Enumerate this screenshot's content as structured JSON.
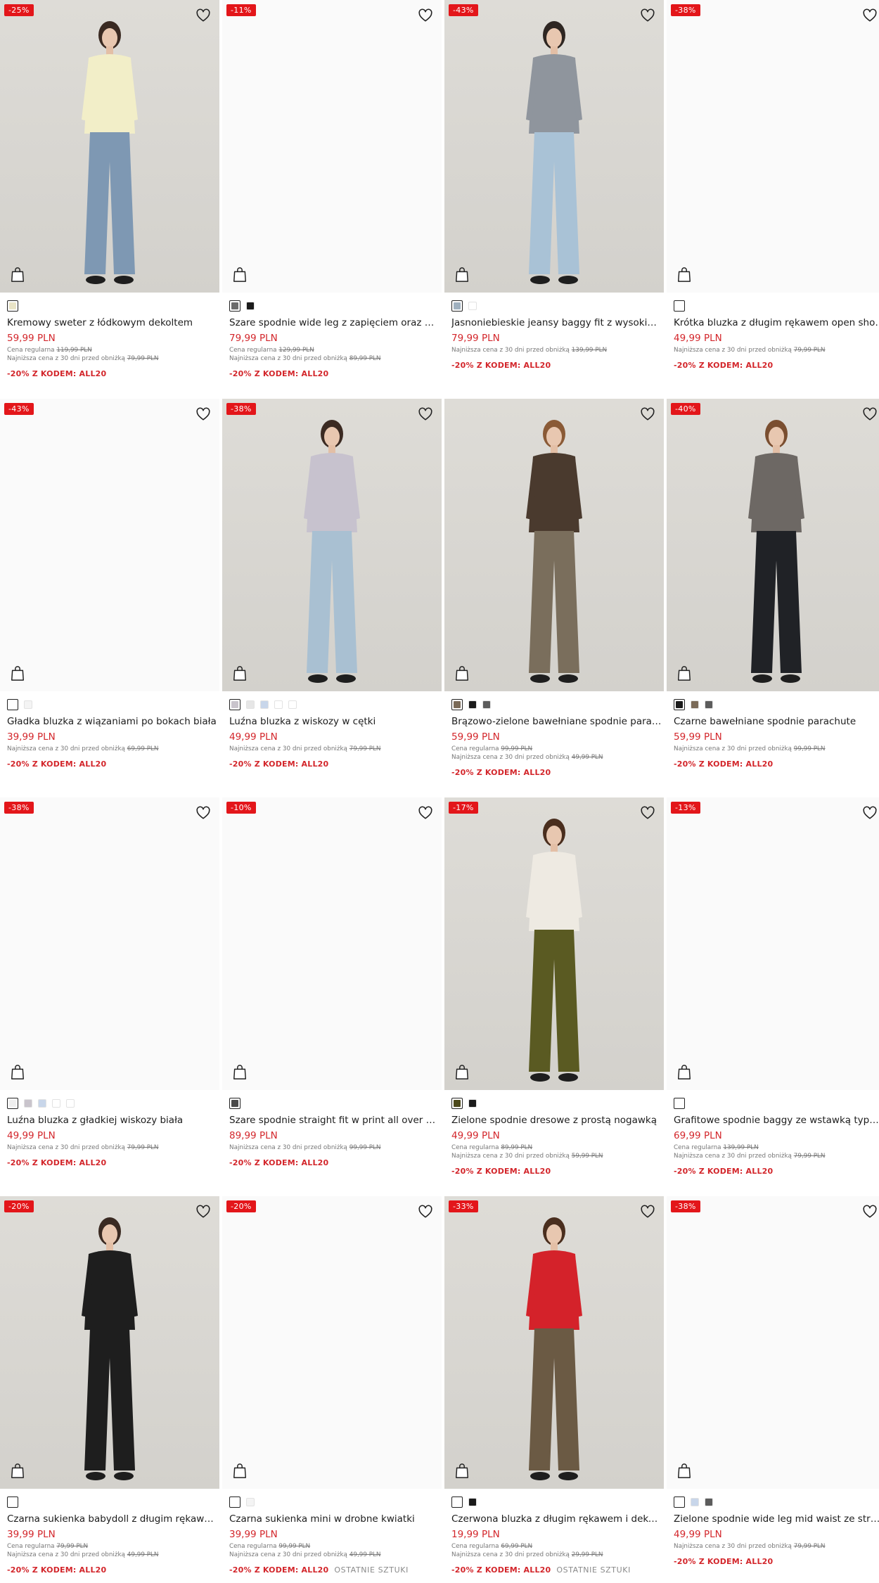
{
  "currency_note": "PLN",
  "products": [
    {
      "badge": "-25%",
      "photo": true,
      "title": "Kremowy sweter z łódkowym dekoltem",
      "price": "59,99 PLN",
      "regular_label": "Cena regularna",
      "regular_price": "119,99 PLN",
      "lowest_label": "Najniższa cena z 30 dni przed obniżką",
      "lowest_price": "79,99 PLN",
      "promo": "-20% Z KODEM: ALL20",
      "extra": "",
      "swatches": [
        "#e9e4c6"
      ],
      "figure": {
        "top": "#f2eec8",
        "bottom": "#7e98b3",
        "hair": "#3a2a22"
      }
    },
    {
      "badge": "-11%",
      "photo": false,
      "title": "Szare spodnie wide leg z zapięciem oraz wiązaniem",
      "price": "79,99 PLN",
      "regular_label": "Cena regularna",
      "regular_price": "129,99 PLN",
      "lowest_label": "Najniższa cena z 30 dni przed obniżką",
      "lowest_price": "89,99 PLN",
      "promo": "-20% Z KODEM: ALL20",
      "extra": "",
      "swatches": [
        "#6b6b6b",
        "#1b1b1b"
      ]
    },
    {
      "badge": "-43%",
      "photo": true,
      "title": "Jasnoniebieskie jeansy baggy fit z wysokim stanem",
      "price": "79,99 PLN",
      "regular_label": "",
      "regular_price": "",
      "lowest_label": "Najniższa cena z 30 dni przed obniżką",
      "lowest_price": "139,99 PLN",
      "promo": "-20% Z KODEM: ALL20",
      "extra": "",
      "swatches": [
        "#9fb0bf",
        "#ffffff"
      ],
      "figure": {
        "top": "#8f959d",
        "bottom": "#a9c2d6",
        "hair": "#2e2622"
      }
    },
    {
      "badge": "-38%",
      "photo": false,
      "title": "Krótka bluzka z długim rękawem open shoulder",
      "price": "49,99 PLN",
      "regular_label": "",
      "regular_price": "",
      "lowest_label": "Najniższa cena z 30 dni przed obniżką",
      "lowest_price": "79,99 PLN",
      "promo": "-20% Z KODEM: ALL20",
      "extra": "",
      "swatches": [
        "#ffffff"
      ]
    },
    {
      "badge": "-43%",
      "photo": false,
      "title": "Gładka bluzka z wiązaniami po bokach biała",
      "price": "39,99 PLN",
      "regular_label": "",
      "regular_price": "",
      "lowest_label": "Najniższa cena z 30 dni przed obniżką",
      "lowest_price": "69,99 PLN",
      "promo": "-20% Z KODEM: ALL20",
      "extra": "",
      "swatches": [
        "#ffffff",
        "#f4f4f4"
      ]
    },
    {
      "badge": "-38%",
      "photo": true,
      "title": "Luźna bluzka z wiskozy w cętki",
      "price": "49,99 PLN",
      "regular_label": "",
      "regular_price": "",
      "lowest_label": "Najniższa cena z 30 dni przed obniżką",
      "lowest_price": "79,99 PLN",
      "promo": "-20% Z KODEM: ALL20",
      "extra": "",
      "swatches": [
        "#c9c4cc",
        "#e6e6e6",
        "#c8d6ea",
        "#ffffff",
        "#ffffff"
      ],
      "figure": {
        "top": "#c7c2ce",
        "bottom": "#a9c0d2",
        "hair": "#3b2a22"
      }
    },
    {
      "badge": "",
      "photo": true,
      "title": "Brązowo-zielone bawełniane spodnie parachute",
      "price": "59,99 PLN",
      "regular_label": "Cena regularna",
      "regular_price": "99,99 PLN",
      "lowest_label": "Najniższa cena z 30 dni przed obniżką",
      "lowest_price": "49,99 PLN",
      "promo": "-20% Z KODEM: ALL20",
      "extra": "",
      "swatches": [
        "#7a6a58",
        "#1b1b1b",
        "#5c5c5c"
      ],
      "figure": {
        "top": "#4a3a2e",
        "bottom": "#7a6e5c",
        "hair": "#8a5a36"
      }
    },
    {
      "badge": "-40%",
      "photo": true,
      "title": "Czarne bawełniane spodnie parachute",
      "price": "59,99 PLN",
      "regular_label": "",
      "regular_price": "",
      "lowest_label": "Najniższa cena z 30 dni przed obniżką",
      "lowest_price": "99,99 PLN",
      "promo": "-20% Z KODEM: ALL20",
      "extra": "",
      "swatches": [
        "#1b1b1b",
        "#7a6a58",
        "#5c5c5c"
      ],
      "figure": {
        "top": "#6d6864",
        "bottom": "#202226",
        "hair": "#7a4e30"
      }
    },
    {
      "badge": "-38%",
      "photo": false,
      "title": "Luźna bluzka z gładkiej wiskozy biała",
      "price": "49,99 PLN",
      "regular_label": "",
      "regular_price": "",
      "lowest_label": "Najniższa cena z 30 dni przed obniżką",
      "lowest_price": "79,99 PLN",
      "promo": "-20% Z KODEM: ALL20",
      "extra": "",
      "swatches": [
        "#efefef",
        "#c9c4cc",
        "#c8d6ea",
        "#ffffff",
        "#ffffff"
      ]
    },
    {
      "badge": "-10%",
      "photo": false,
      "title": "Szare spodnie straight fit w print all over Hello Kitty",
      "price": "89,99 PLN",
      "regular_label": "",
      "regular_price": "",
      "lowest_label": "Najniższa cena z 30 dni przed obniżką",
      "lowest_price": "99,99 PLN",
      "promo": "-20% Z KODEM: ALL20",
      "extra": "",
      "swatches": [
        "#4a4a4a"
      ]
    },
    {
      "badge": "-17%",
      "photo": true,
      "title": "Zielone spodnie dresowe z prostą nogawką",
      "price": "49,99 PLN",
      "regular_label": "Cena regularna",
      "regular_price": "89,99 PLN",
      "lowest_label": "Najniższa cena z 30 dni przed obniżką",
      "lowest_price": "59,99 PLN",
      "promo": "-20% Z KODEM: ALL20",
      "extra": "",
      "swatches": [
        "#4d4a1c",
        "#1b1b1b"
      ],
      "figure": {
        "top": "#eeeae2",
        "bottom": "#5a5a22",
        "hair": "#4a2e1e"
      }
    },
    {
      "badge": "-13%",
      "photo": false,
      "title": "Grafitowe spodnie baggy ze wstawką typu bokserka",
      "price": "69,99 PLN",
      "regular_label": "Cena regularna",
      "regular_price": "139,99 PLN",
      "lowest_label": "Najniższa cena z 30 dni przed obniżką",
      "lowest_price": "79,99 PLN",
      "promo": "-20% Z KODEM: ALL20",
      "extra": "",
      "swatches": [
        "#ffffff"
      ]
    },
    {
      "badge": "-20%",
      "photo": true,
      "title": "Czarna sukienka babydoll z długim rękawem",
      "price": "39,99 PLN",
      "regular_label": "Cena regularna",
      "regular_price": "79,99 PLN",
      "lowest_label": "Najniższa cena z 30 dni przed obniżką",
      "lowest_price": "49,99 PLN",
      "promo": "-20% Z KODEM: ALL20",
      "extra": "",
      "swatches": [
        "#ffffff"
      ],
      "figure": {
        "top": "#1e1e1e",
        "bottom": "#1e1e1e",
        "hair": "#3a2a22"
      }
    },
    {
      "badge": "-20%",
      "photo": false,
      "title": "Czarna sukienka mini w drobne kwiatki",
      "price": "39,99 PLN",
      "regular_label": "Cena regularna",
      "regular_price": "99,99 PLN",
      "lowest_label": "Najniższa cena z 30 dni przed obniżką",
      "lowest_price": "49,99 PLN",
      "promo": "-20% Z KODEM: ALL20",
      "extra": "OSTATNIE SZTUKI",
      "swatches": [
        "#ffffff",
        "#f4f4f4"
      ]
    },
    {
      "badge": "-33%",
      "photo": true,
      "title": "Czerwona bluzka z długim rękawem i dekoltem typu carmen",
      "price": "19,99 PLN",
      "regular_label": "Cena regularna",
      "regular_price": "69,99 PLN",
      "lowest_label": "Najniższa cena z 30 dni przed obniżką",
      "lowest_price": "29,99 PLN",
      "promo": "-20% Z KODEM: ALL20",
      "extra": "OSTATNIE SZTUKI",
      "swatches": [
        "#ffffff",
        "#1b1b1b"
      ],
      "figure": {
        "top": "#d4222a",
        "bottom": "#6b5a44",
        "hair": "#4a2e1e"
      }
    },
    {
      "badge": "-38%",
      "photo": false,
      "title": "Zielone spodnie wide leg mid waist ze strukturalnej tkaniny",
      "price": "49,99 PLN",
      "regular_label": "",
      "regular_price": "",
      "lowest_label": "Najniższa cena z 30 dni przed obniżką",
      "lowest_price": "79,99 PLN",
      "promo": "-20% Z KODEM: ALL20",
      "extra": "",
      "swatches": [
        "#ffffff",
        "#c8d6ea",
        "#5c5c5c"
      ]
    }
  ]
}
